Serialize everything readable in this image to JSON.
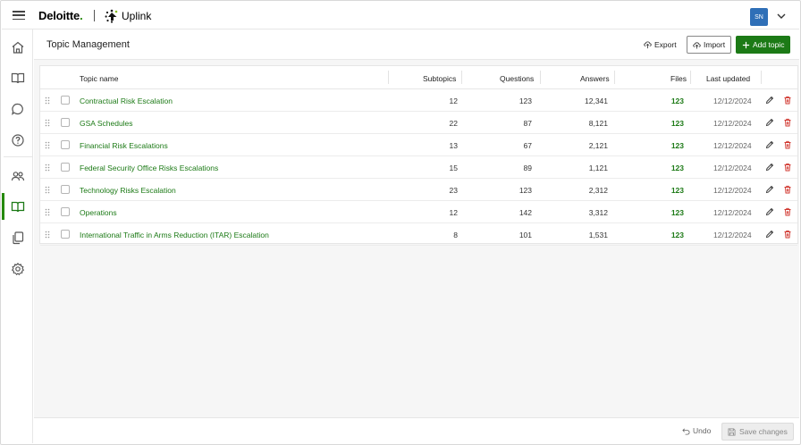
{
  "header": {
    "brand": "Deloitte",
    "brand_dot": ".",
    "product": "Uplink",
    "avatar_initials": "SN"
  },
  "page": {
    "title": "Topic Management",
    "export_label": "Export",
    "import_label": "Import",
    "add_label": "Add topic"
  },
  "table": {
    "columns": [
      "Topic name",
      "Subtopics",
      "Questions",
      "Answers",
      "Files",
      "Last updated"
    ],
    "rows": [
      {
        "name": "Contractual Risk Escalation",
        "subtopics": "12",
        "questions": "123",
        "answers": "12,341",
        "files": "123",
        "updated": "12/12/2024"
      },
      {
        "name": "GSA Schedules",
        "subtopics": "22",
        "questions": "87",
        "answers": "8,121",
        "files": "123",
        "updated": "12/12/2024"
      },
      {
        "name": "Financial Risk Escalations",
        "subtopics": "13",
        "questions": "67",
        "answers": "2,121",
        "files": "123",
        "updated": "12/12/2024"
      },
      {
        "name": "Federal Security Office Risks Escalations",
        "subtopics": "15",
        "questions": "89",
        "answers": "1,121",
        "files": "123",
        "updated": "12/12/2024"
      },
      {
        "name": "Technology Risks Escalation",
        "subtopics": "23",
        "questions": "123",
        "answers": "2,312",
        "files": "123",
        "updated": "12/12/2024"
      },
      {
        "name": "Operations",
        "subtopics": "12",
        "questions": "142",
        "answers": "3,312",
        "files": "123",
        "updated": "12/12/2024"
      },
      {
        "name": "International Traffic in Arms Reduction (ITAR) Escalation",
        "subtopics": "8",
        "questions": "101",
        "answers": "1,531",
        "files": "123",
        "updated": "12/12/2024"
      }
    ]
  },
  "footer": {
    "undo_label": "Undo",
    "save_label": "Save changes"
  },
  "colors": {
    "accent": "#1c7a16",
    "delete": "#d0342c",
    "avatar": "#2f6fb7"
  },
  "icons": {
    "sidebar": [
      "home-icon",
      "book-icon",
      "chat-icon",
      "help-icon",
      "users-icon",
      "topics-icon",
      "documents-icon",
      "settings-icon"
    ]
  }
}
